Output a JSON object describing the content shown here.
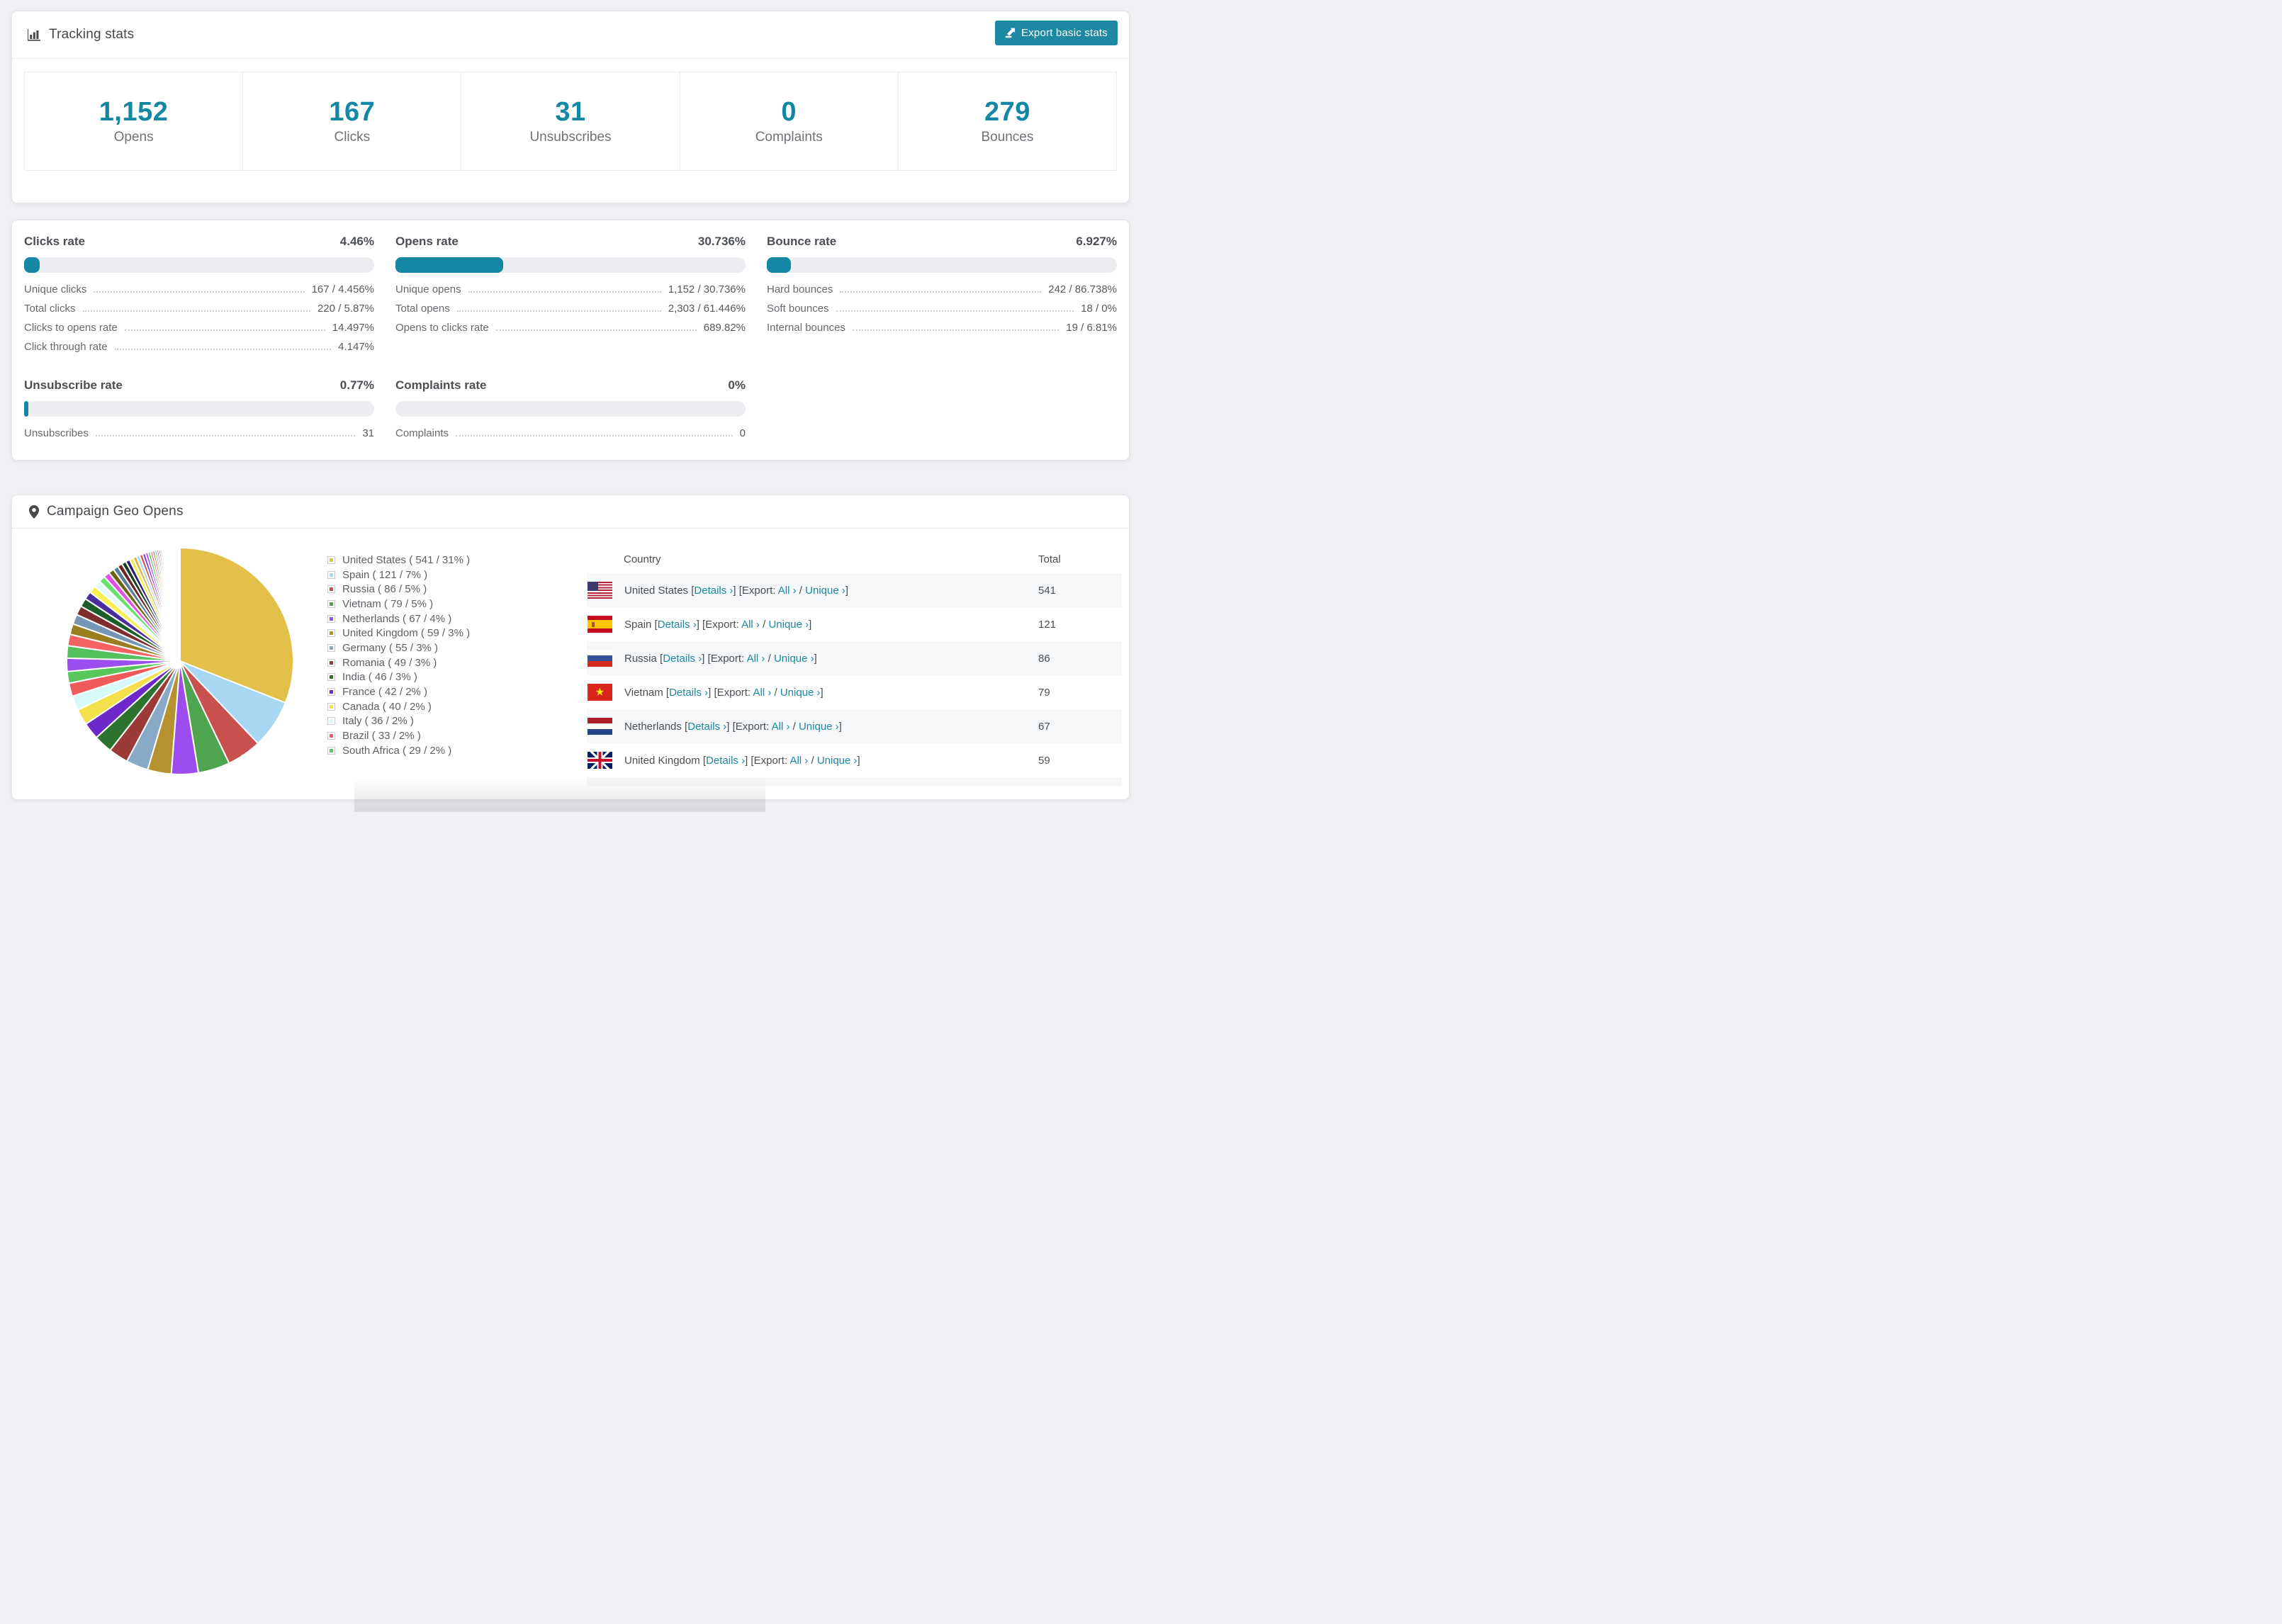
{
  "app": {
    "background": "#f0f1f4",
    "accent": "#1487a4",
    "button_color": "#1d88a2",
    "link_color": "#1b88a2"
  },
  "tracking": {
    "title": "Tracking stats",
    "export_button": "Export basic stats",
    "stats": [
      {
        "value": "1,152",
        "label": "Opens"
      },
      {
        "value": "167",
        "label": "Clicks"
      },
      {
        "value": "31",
        "label": "Unsubscribes"
      },
      {
        "value": "0",
        "label": "Complaints"
      },
      {
        "value": "279",
        "label": "Bounces"
      }
    ]
  },
  "rates": {
    "sections": [
      {
        "title": "Clicks rate",
        "value": "4.46%",
        "percent": 4.46,
        "rows": [
          {
            "label": "Unique clicks",
            "value": "167 / 4.456%"
          },
          {
            "label": "Total clicks",
            "value": "220 / 5.87%"
          },
          {
            "label": "Clicks to opens rate",
            "value": "14.497%"
          },
          {
            "label": "Click through rate",
            "value": "4.147%"
          }
        ]
      },
      {
        "title": "Opens rate",
        "value": "30.736%",
        "percent": 30.736,
        "rows": [
          {
            "label": "Unique opens",
            "value": "1,152 / 30.736%"
          },
          {
            "label": "Total opens",
            "value": "2,303 / 61.446%"
          },
          {
            "label": "Opens to clicks rate",
            "value": "689.82%"
          }
        ]
      },
      {
        "title": "Bounce rate",
        "value": "6.927%",
        "percent": 6.927,
        "rows": [
          {
            "label": "Hard bounces",
            "value": "242 / 86.738%"
          },
          {
            "label": "Soft bounces",
            "value": "18 / 0%"
          },
          {
            "label": "Internal bounces",
            "value": "19 / 6.81%"
          }
        ]
      },
      {
        "title": "Unsubscribe rate",
        "value": "0.77%",
        "percent": 0.77,
        "rows": [
          {
            "label": "Unsubscribes",
            "value": "31"
          }
        ]
      },
      {
        "title": "Complaints rate",
        "value": "0%",
        "percent": 0,
        "rows": [
          {
            "label": "Complaints",
            "value": "0"
          }
        ]
      }
    ]
  },
  "geo": {
    "title": "Campaign Geo Opens",
    "table": {
      "headers": [
        "Country",
        "Total"
      ],
      "links": {
        "details": "Details ›",
        "export_label": "Export:",
        "all": "All ›",
        "unique": "Unique ›"
      },
      "rows": [
        {
          "country": "United States",
          "flag": "us",
          "total": "541"
        },
        {
          "country": "Spain",
          "flag": "es",
          "total": "121"
        },
        {
          "country": "Russia",
          "flag": "ru",
          "total": "86"
        },
        {
          "country": "Vietnam",
          "flag": "vn",
          "total": "79"
        },
        {
          "country": "Netherlands",
          "flag": "nl",
          "total": "67"
        },
        {
          "country": "United Kingdom",
          "flag": "gb",
          "total": "59"
        },
        {
          "country": "Germany",
          "flag": "de",
          "total": "55",
          "partial": true
        }
      ]
    }
  },
  "chart_data": {
    "type": "pie",
    "title": "Campaign Geo Opens",
    "legend_position": "right",
    "start_angle_deg": -90,
    "direction": "clockwise",
    "series": [
      {
        "name": "United States",
        "value": 541,
        "pct": 31,
        "color": "#e3c04a"
      },
      {
        "name": "Spain",
        "value": 121,
        "pct": 7,
        "color": "#a8d7f4"
      },
      {
        "name": "Russia",
        "value": 86,
        "pct": 5,
        "color": "#c8504e"
      },
      {
        "name": "Vietnam",
        "value": 79,
        "pct": 5,
        "color": "#4ea44f"
      },
      {
        "name": "Netherlands",
        "value": 67,
        "pct": 4,
        "color": "#9b4df0"
      },
      {
        "name": "United Kingdom",
        "value": 59,
        "pct": 3,
        "color": "#b6922e"
      },
      {
        "name": "Germany",
        "value": 55,
        "pct": 3,
        "color": "#88aac7"
      },
      {
        "name": "Romania",
        "value": 49,
        "pct": 3,
        "color": "#9c3a39"
      },
      {
        "name": "India",
        "value": 46,
        "pct": 3,
        "color": "#2c7330"
      },
      {
        "name": "France",
        "value": 42,
        "pct": 2,
        "color": "#6d28c9"
      },
      {
        "name": "Canada",
        "value": 40,
        "pct": 2,
        "color": "#f3e04b"
      },
      {
        "name": "Italy",
        "value": 36,
        "pct": 2,
        "color": "#d6f9f9"
      },
      {
        "name": "Brazil",
        "value": 33,
        "pct": 2,
        "color": "#ef5a5a"
      },
      {
        "name": "South Africa",
        "value": 29,
        "pct": 2,
        "color": "#57c65c"
      }
    ],
    "others": {
      "total": 462,
      "note": "many small unlabeled country slices",
      "slice_count": 55,
      "decay": 0.93,
      "palette": [
        "#9b4df0",
        "#54c05e",
        "#f56262",
        "#9a7f22",
        "#7697b4",
        "#7e2d2d",
        "#1d5c2a",
        "#4b2e9e",
        "#f7f051",
        "#e3fbfa",
        "#67e06e",
        "#e44fe4",
        "#6e6414",
        "#5a7d9a",
        "#6b2424",
        "#173f1e",
        "#241d6b",
        "#f0ea4e",
        "#d9b93a",
        "#a8d7f4",
        "#c8504e",
        "#8a2be2"
      ]
    }
  }
}
